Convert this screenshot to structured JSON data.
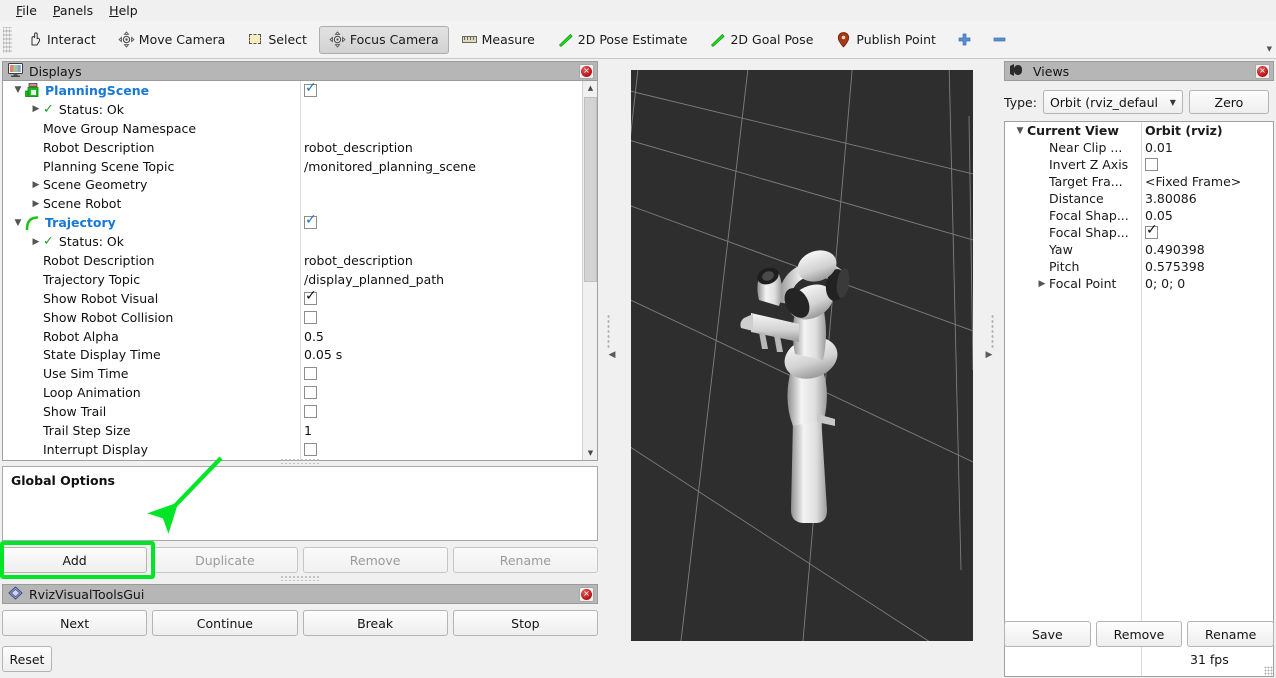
{
  "menubar": {
    "items": [
      {
        "label": "File",
        "mnemonic": "F"
      },
      {
        "label": "Panels",
        "mnemonic": "P"
      },
      {
        "label": "Help",
        "mnemonic": "H"
      }
    ]
  },
  "toolbar": {
    "buttons": [
      {
        "label": "Interact",
        "icon": "hand-icon",
        "active": false
      },
      {
        "label": "Move Camera",
        "icon": "move-camera-icon",
        "active": false
      },
      {
        "label": "Select",
        "icon": "select-icon",
        "active": false
      },
      {
        "label": "Focus Camera",
        "icon": "focus-camera-icon",
        "active": true
      },
      {
        "label": "Measure",
        "icon": "ruler-icon",
        "active": false
      },
      {
        "label": "2D Pose Estimate",
        "icon": "pose-arrow-icon",
        "active": false
      },
      {
        "label": "2D Goal Pose",
        "icon": "pose-arrow-icon",
        "active": false
      },
      {
        "label": "Publish Point",
        "icon": "map-pin-icon",
        "active": false
      }
    ],
    "plus_icon": "plus-icon",
    "minus_icon": "minus-icon",
    "overflow_icon": "chevron-down-icon"
  },
  "displays": {
    "title": "Displays",
    "title_icon": "display-monitor-icon",
    "close_icon": "close-icon",
    "rows": [
      {
        "indent": 0,
        "twist": "open",
        "icon": "planning-scene-icon",
        "label": "PlanningScene",
        "style": "top",
        "value_type": "checkbox",
        "checked": true,
        "value": ""
      },
      {
        "indent": 1,
        "twist": "closed",
        "icon": "ok-check-icon",
        "label": "Status: Ok",
        "style": "plain",
        "value_type": "none",
        "value": ""
      },
      {
        "indent": 1,
        "twist": "none",
        "icon": "",
        "label": "Move Group Namespace",
        "style": "plain",
        "value_type": "text",
        "value": ""
      },
      {
        "indent": 1,
        "twist": "none",
        "icon": "",
        "label": "Robot Description",
        "style": "plain",
        "value_type": "text",
        "value": "robot_description"
      },
      {
        "indent": 1,
        "twist": "none",
        "icon": "",
        "label": "Planning Scene Topic",
        "style": "plain",
        "value_type": "text",
        "value": "/monitored_planning_scene"
      },
      {
        "indent": 1,
        "twist": "closed",
        "icon": "",
        "label": "Scene Geometry",
        "style": "plain",
        "value_type": "none",
        "value": ""
      },
      {
        "indent": 1,
        "twist": "closed",
        "icon": "",
        "label": "Scene Robot",
        "style": "plain",
        "value_type": "none",
        "value": ""
      },
      {
        "indent": 0,
        "twist": "open",
        "icon": "trajectory-icon",
        "label": "Trajectory",
        "style": "top",
        "value_type": "checkbox",
        "checked": true,
        "value": ""
      },
      {
        "indent": 1,
        "twist": "closed",
        "icon": "ok-check-icon",
        "label": "Status: Ok",
        "style": "plain",
        "value_type": "none",
        "value": ""
      },
      {
        "indent": 1,
        "twist": "none",
        "icon": "",
        "label": "Robot Description",
        "style": "plain",
        "value_type": "text",
        "value": "robot_description"
      },
      {
        "indent": 1,
        "twist": "none",
        "icon": "",
        "label": "Trajectory Topic",
        "style": "plain",
        "value_type": "text",
        "value": "/display_planned_path"
      },
      {
        "indent": 1,
        "twist": "none",
        "icon": "",
        "label": "Show Robot Visual",
        "style": "plain",
        "value_type": "checkbox",
        "checked": true,
        "black": true,
        "value": ""
      },
      {
        "indent": 1,
        "twist": "none",
        "icon": "",
        "label": "Show Robot Collision",
        "style": "plain",
        "value_type": "checkbox",
        "checked": false,
        "value": ""
      },
      {
        "indent": 1,
        "twist": "none",
        "icon": "",
        "label": "Robot Alpha",
        "style": "plain",
        "value_type": "text",
        "value": "0.5"
      },
      {
        "indent": 1,
        "twist": "none",
        "icon": "",
        "label": "State Display Time",
        "style": "plain",
        "value_type": "text",
        "value": "0.05 s"
      },
      {
        "indent": 1,
        "twist": "none",
        "icon": "",
        "label": "Use Sim Time",
        "style": "plain",
        "value_type": "checkbox",
        "checked": false,
        "value": ""
      },
      {
        "indent": 1,
        "twist": "none",
        "icon": "",
        "label": "Loop Animation",
        "style": "plain",
        "value_type": "checkbox",
        "checked": false,
        "value": ""
      },
      {
        "indent": 1,
        "twist": "none",
        "icon": "",
        "label": "Show Trail",
        "style": "plain",
        "value_type": "checkbox",
        "checked": false,
        "value": ""
      },
      {
        "indent": 1,
        "twist": "none",
        "icon": "",
        "label": "Trail Step Size",
        "style": "plain",
        "value_type": "text",
        "value": "1"
      },
      {
        "indent": 1,
        "twist": "none",
        "icon": "",
        "label": "Interrupt Display",
        "style": "plain",
        "value_type": "checkbox",
        "checked": false,
        "value": ""
      }
    ],
    "global_options_title": "Global Options",
    "buttons": [
      {
        "label": "Add",
        "disabled": false,
        "highlighted": true
      },
      {
        "label": "Duplicate",
        "disabled": true,
        "highlighted": false
      },
      {
        "label": "Remove",
        "disabled": true,
        "highlighted": false
      },
      {
        "label": "Rename",
        "disabled": true,
        "highlighted": false
      }
    ]
  },
  "rviz_visual_tools": {
    "title": "RvizVisualToolsGui",
    "title_icon": "diamond-icon",
    "close_icon": "close-icon",
    "buttons": [
      {
        "label": "Next"
      },
      {
        "label": "Continue"
      },
      {
        "label": "Break"
      },
      {
        "label": "Stop"
      }
    ],
    "reset_label": "Reset"
  },
  "viewport": {
    "collapse_left_icon": "triangle-left-icon",
    "collapse_right_icon": "triangle-right-icon",
    "background_color": "#2e2e2e",
    "grid_color": "#8a8a8a",
    "robot_color": "#e8e8e8",
    "robot_name": "panda-arm"
  },
  "views": {
    "title": "Views",
    "title_icon": "camera-icon",
    "close_icon": "close-icon",
    "type_label": "Type:",
    "type_value": "Orbit (rviz_defaul",
    "zero_label": "Zero",
    "rows": [
      {
        "indent": 0,
        "twist": "open",
        "label": "Current View",
        "value": "Orbit (rviz)",
        "bold": true,
        "value_type": "text"
      },
      {
        "indent": 1,
        "twist": "none",
        "label": "Near Clip ...",
        "value": "0.01",
        "bold": false,
        "value_type": "text"
      },
      {
        "indent": 1,
        "twist": "none",
        "label": "Invert Z Axis",
        "value": "",
        "bold": false,
        "value_type": "checkbox",
        "checked": false
      },
      {
        "indent": 1,
        "twist": "none",
        "label": "Target Fra...",
        "value": "<Fixed Frame>",
        "bold": false,
        "value_type": "text"
      },
      {
        "indent": 1,
        "twist": "none",
        "label": "Distance",
        "value": "3.80086",
        "bold": false,
        "value_type": "text"
      },
      {
        "indent": 1,
        "twist": "none",
        "label": "Focal Shap...",
        "value": "0.05",
        "bold": false,
        "value_type": "text"
      },
      {
        "indent": 1,
        "twist": "none",
        "label": "Focal Shap...",
        "value": "",
        "bold": false,
        "value_type": "checkbox",
        "checked": true,
        "black": true
      },
      {
        "indent": 1,
        "twist": "none",
        "label": "Yaw",
        "value": "0.490398",
        "bold": false,
        "value_type": "text"
      },
      {
        "indent": 1,
        "twist": "none",
        "label": "Pitch",
        "value": "0.575398",
        "bold": false,
        "value_type": "text"
      },
      {
        "indent": 1,
        "twist": "closed",
        "label": "Focal Point",
        "value": "0; 0; 0",
        "bold": false,
        "value_type": "text"
      }
    ],
    "buttons": [
      {
        "label": "Save"
      },
      {
        "label": "Remove"
      },
      {
        "label": "Rename"
      }
    ]
  },
  "status": {
    "fps": "31 fps"
  },
  "annotation": {
    "arrow_color": "#00e627",
    "highlight_color": "#00e627",
    "target": "Add"
  }
}
